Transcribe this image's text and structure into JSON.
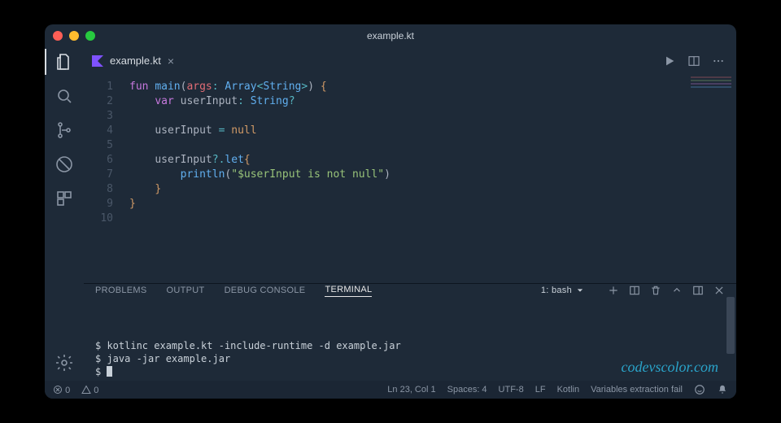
{
  "window": {
    "title": "example.kt"
  },
  "tab": {
    "filename": "example.kt"
  },
  "code": {
    "lines": [
      {
        "n": 1,
        "tokens": [
          [
            "kw",
            "fun "
          ],
          [
            "fn",
            "main"
          ],
          [
            "pn",
            "("
          ],
          [
            "var",
            "args"
          ],
          [
            "op",
            ": "
          ],
          [
            "type",
            "Array"
          ],
          [
            "op",
            "<"
          ],
          [
            "type",
            "String"
          ],
          [
            "op",
            ">"
          ],
          [
            "pn",
            ") "
          ],
          [
            "brace",
            "{"
          ]
        ]
      },
      {
        "n": 2,
        "indent": 1,
        "tokens": [
          [
            "kw",
            "var "
          ],
          [
            "nm",
            "userInput"
          ],
          [
            "op",
            ": "
          ],
          [
            "type",
            "String"
          ],
          [
            "op",
            "?"
          ]
        ]
      },
      {
        "n": 3,
        "tokens": []
      },
      {
        "n": 4,
        "indent": 1,
        "tokens": [
          [
            "nm",
            "userInput "
          ],
          [
            "op",
            "= "
          ],
          [
            "null",
            "null"
          ]
        ]
      },
      {
        "n": 5,
        "tokens": []
      },
      {
        "n": 6,
        "indent": 1,
        "tokens": [
          [
            "nm",
            "userInput"
          ],
          [
            "op",
            "?."
          ],
          [
            "fn",
            "let"
          ],
          [
            "brace",
            "{"
          ]
        ]
      },
      {
        "n": 7,
        "indent": 2,
        "tokens": [
          [
            "fn",
            "println"
          ],
          [
            "pn",
            "("
          ],
          [
            "str",
            "\"$userInput is not null\""
          ],
          [
            "pn",
            ")"
          ]
        ]
      },
      {
        "n": 8,
        "indent": 1,
        "tokens": [
          [
            "brace",
            "}"
          ]
        ]
      },
      {
        "n": 9,
        "tokens": [
          [
            "brace",
            "}"
          ]
        ]
      },
      {
        "n": 10,
        "tokens": []
      }
    ]
  },
  "panel": {
    "tabs": {
      "problems": "PROBLEMS",
      "output": "OUTPUT",
      "debug": "DEBUG CONSOLE",
      "terminal": "TERMINAL"
    },
    "terminal_selector": "1: bash",
    "terminal_lines": [
      "$ kotlinc example.kt -include-runtime -d example.jar",
      "$ java -jar example.jar",
      "$ "
    ]
  },
  "status": {
    "errors": "0",
    "warnings": "0",
    "cursor": "Ln 23, Col 1",
    "spaces": "Spaces: 4",
    "encoding": "UTF-8",
    "eol": "LF",
    "lang": "Kotlin",
    "extra": "Variables extraction fail"
  },
  "watermark": "codevscolor.com"
}
